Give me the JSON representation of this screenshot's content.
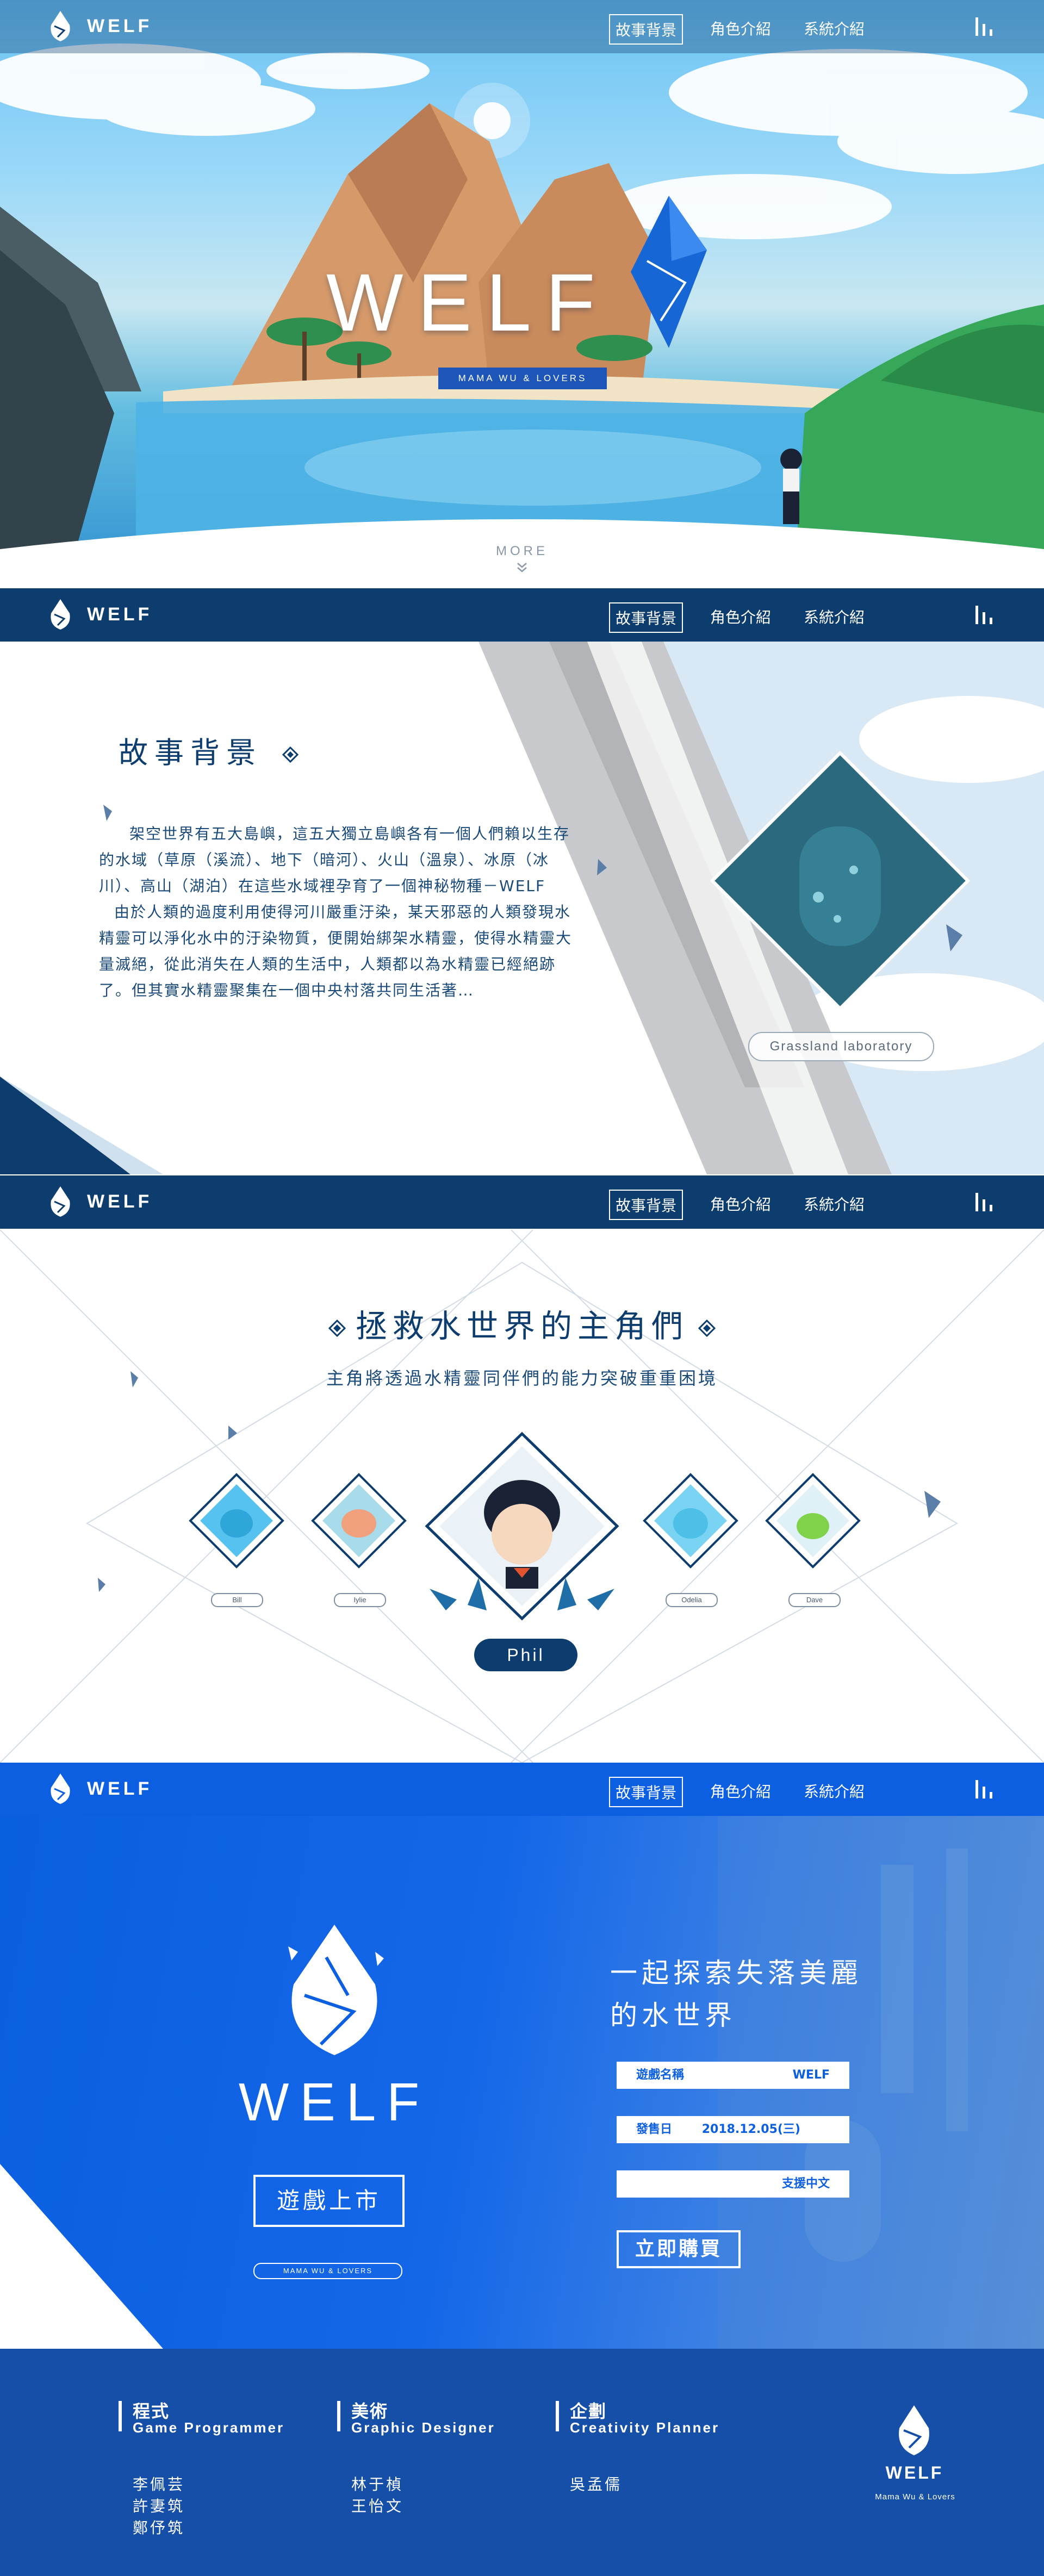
{
  "nav": {
    "brand": "WELF",
    "links": [
      "故事背景",
      "角色介紹",
      "系統介紹"
    ]
  },
  "hero": {
    "title": "WELF",
    "subtitle": "MAMA WU & LOVERS",
    "more": "MORE"
  },
  "story": {
    "title": "故事背景",
    "paragraphs": [
      "架空世界有五大島嶼，這五大獨立島嶼各有一個人們賴以生存的水域（草原（溪流）、地下（暗河）、火山（溫泉）、冰原（冰川）、高山（湖泊）在這些水域裡孕育了一個神秘物種－WELF",
      "由於人類的過度利用使得河川嚴重汙染，某天邪惡的人類發現水精靈可以淨化水中的汙染物質，便開始綁架水精靈，使得水精靈大量滅絕，從此消失在人類的生活中，人類都以為水精靈已經絕跡了。但其實水精靈聚集在一個中央村落共同生活著…"
    ],
    "lab_label": "Grassland laboratory"
  },
  "characters": {
    "title": "拯救水世界的主角們",
    "subtitle": "主角將透過水精靈同伴們的能力突破重重困境",
    "tags": [
      "Bill",
      "Iylie",
      "Odelia",
      "Dave"
    ],
    "main": "Phil"
  },
  "release": {
    "brand": "WELF",
    "launch": "遊戲上市",
    "small": "MAMA WU & LOVERS",
    "heading_1": "一起探索失落美麗",
    "heading_2": "的水世界",
    "info": [
      {
        "key": "遊戲名稱",
        "value": "WELF"
      },
      {
        "key": "發售日",
        "value": "2018.12.05(三)"
      },
      {
        "key": "",
        "value": "支援中文"
      }
    ],
    "buy": "立即購買"
  },
  "footer": {
    "teams": [
      {
        "role": "程式",
        "role_en": "Game Programmer",
        "names": [
          "李佩芸",
          "許妻筑",
          "鄭伃筑"
        ]
      },
      {
        "role": "美術",
        "role_en": "Graphic Designer",
        "names": [
          "林于楨",
          "王怡文"
        ]
      },
      {
        "role": "企劃",
        "role_en": "Creativity Planner",
        "names": [
          "吳孟儒"
        ]
      }
    ],
    "brand": "WELF",
    "tagline": "Mama Wu & Lovers"
  },
  "colors": {
    "navy": "#0d3d6e",
    "bright_blue": "#0b5fe0",
    "footer_blue": "#164fa8"
  }
}
